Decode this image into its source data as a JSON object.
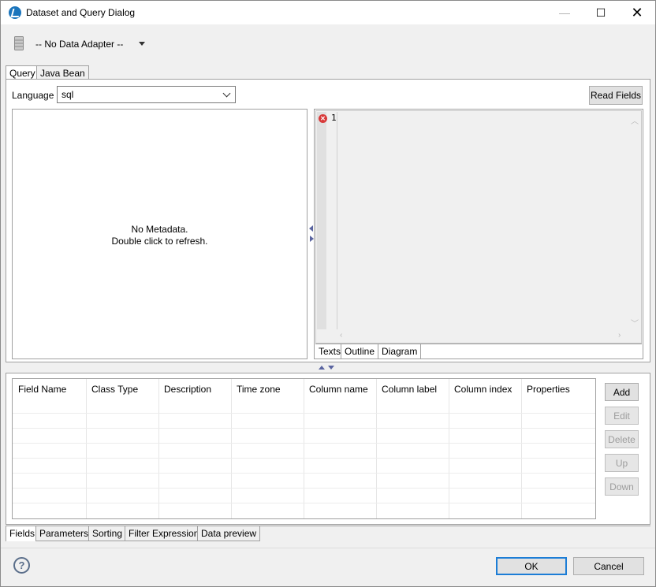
{
  "window": {
    "title": "Dataset and Query Dialog"
  },
  "titlebar_buttons": {
    "minimize": "—",
    "maximize": "☐",
    "close": "✕"
  },
  "adapter": {
    "label": "-- No Data Adapter --",
    "icon": "database-icon"
  },
  "query_tabs": [
    {
      "label": "Query",
      "active": true
    },
    {
      "label": "Java Bean",
      "active": false
    }
  ],
  "language": {
    "label": "Language",
    "value": "sql"
  },
  "read_fields_label": "Read Fields",
  "metadata": {
    "line1": "No Metadata.",
    "line2": "Double click to refresh."
  },
  "editor": {
    "line_number": "1",
    "error_icon": "error-icon",
    "tabs": [
      {
        "label": "Texts",
        "active": true
      },
      {
        "label": "Outline",
        "active": false
      },
      {
        "label": "Diagram",
        "active": false
      }
    ]
  },
  "fields_table": {
    "columns": [
      "Field Name",
      "Class Type",
      "Description",
      "Time zone",
      "Column name",
      "Column label",
      "Column index",
      "Properties"
    ],
    "rows": []
  },
  "side_buttons": [
    {
      "label": "Add",
      "enabled": true
    },
    {
      "label": "Edit",
      "enabled": false
    },
    {
      "label": "Delete",
      "enabled": false
    },
    {
      "label": "Up",
      "enabled": false
    },
    {
      "label": "Down",
      "enabled": false
    }
  ],
  "bottom_tabs": [
    {
      "label": "Fields",
      "active": true
    },
    {
      "label": "Parameters",
      "active": false
    },
    {
      "label": "Sorting",
      "active": false
    },
    {
      "label": "Filter Expression",
      "active": false
    },
    {
      "label": "Data preview",
      "active": false
    }
  ],
  "footer": {
    "help_glyph": "?",
    "ok_label": "OK",
    "cancel_label": "Cancel"
  },
  "colors": {
    "accent": "#1c7dd6",
    "error": "#d83a3a",
    "panel_bg": "#f0f0f0"
  }
}
